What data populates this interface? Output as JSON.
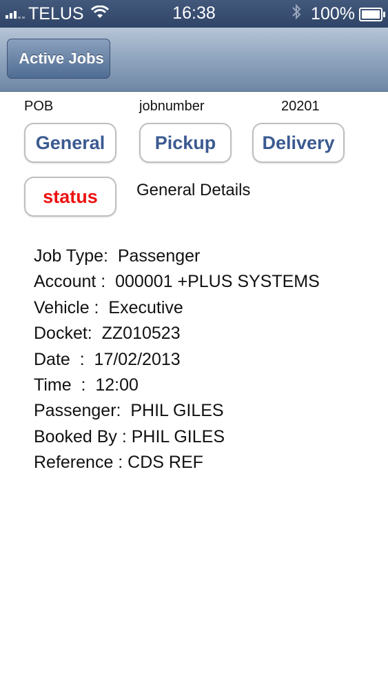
{
  "status_bar": {
    "carrier": "TELUS",
    "time": "16:38",
    "battery": "100%"
  },
  "nav": {
    "back_label": "Active Jobs"
  },
  "job": {
    "status_code": "POB",
    "number_label": "jobnumber",
    "number_value": "20201"
  },
  "tabs": {
    "general": "General",
    "pickup": "Pickup",
    "delivery": "Delivery",
    "status": "status"
  },
  "section_title": "General Details",
  "details": [
    "Job Type:  Passenger",
    "Account :  000001 +PLUS SYSTEMS",
    "Vehicle :  Executive",
    "Docket:  ZZ010523",
    "Date  :  17/02/2013",
    "Time  :  12:00",
    "Passenger:  PHIL GILES",
    "Booked By : PHIL GILES",
    "Reference : CDS REF"
  ],
  "colors": {
    "tab_text": "#3b5a91",
    "status_text": "#ee1111"
  }
}
